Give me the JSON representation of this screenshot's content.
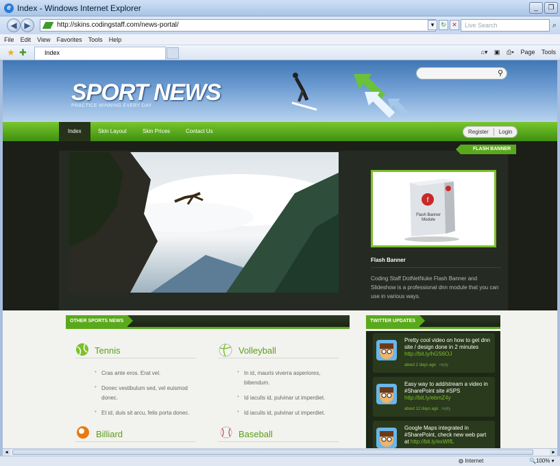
{
  "window": {
    "title": "Index - Windows Internet Explorer",
    "min_label": "_",
    "max_label": "❐"
  },
  "address": {
    "url": "http://skins.codingstaff.com/news-portal/",
    "search_placeholder": "Live Search"
  },
  "menu": [
    "File",
    "Edit",
    "View",
    "Favorites",
    "Tools",
    "Help"
  ],
  "tab": {
    "label": "Index"
  },
  "toolbar": {
    "page_label": "Page",
    "tools_label": "Tools"
  },
  "site": {
    "logo": "SPORT NEWS",
    "tagline": "PRACTICE WINNING EVERY DAY",
    "nav": [
      "Index",
      "Skin Layout",
      "Skin Prices",
      "Contact Us"
    ],
    "register": "Register",
    "login": "Login"
  },
  "flash": {
    "tag": "FLASH BANNER",
    "title": "Flash Banner",
    "description": "Coding Staff DotNetNuke Flash Banner and Slideshow is a professional dnn module that you can use in various ways.",
    "box_label": "Flash Banner Module"
  },
  "sports": {
    "header": "OTHER SPORTS NEWS",
    "categories": [
      {
        "title": "Tennis",
        "items": [
          "Cras ante eros. Erat vel.",
          "Donec vestibulum sed, vel euismod donec.",
          "Et id, duis sit arcu, felis porta donec."
        ]
      },
      {
        "title": "Volleyball",
        "items": [
          "In id, mauris viverra asperiores, bibendum.",
          "Id iaculis id, pulvinar ut imperdiet.",
          "Id iaculis id, pulvinar ut imperdiet."
        ]
      },
      {
        "title": "Billiard",
        "items": []
      },
      {
        "title": "Baseball",
        "items": []
      }
    ]
  },
  "twitter": {
    "header": "TWITTER UPDATES",
    "tweets": [
      {
        "text": "Pretty cool video on how to get dnn site / design done in 2 minutes",
        "link": "http://bit.ly/hGS6OJ",
        "time": "about 2 days ago",
        "reply": "reply"
      },
      {
        "text": "Easy way to add/stream a video in #SharePoint site #SPS",
        "link": "http://bit.ly/ebmZ4y",
        "time": "about 12 days ago",
        "reply": "reply"
      },
      {
        "text": "Google Maps integrated in #SharePoint, check new web part at",
        "link": "http://bit.ly/exWIfL",
        "time": "",
        "reply": ""
      }
    ]
  },
  "status": {
    "zone": "Internet",
    "zoom": "100%"
  }
}
